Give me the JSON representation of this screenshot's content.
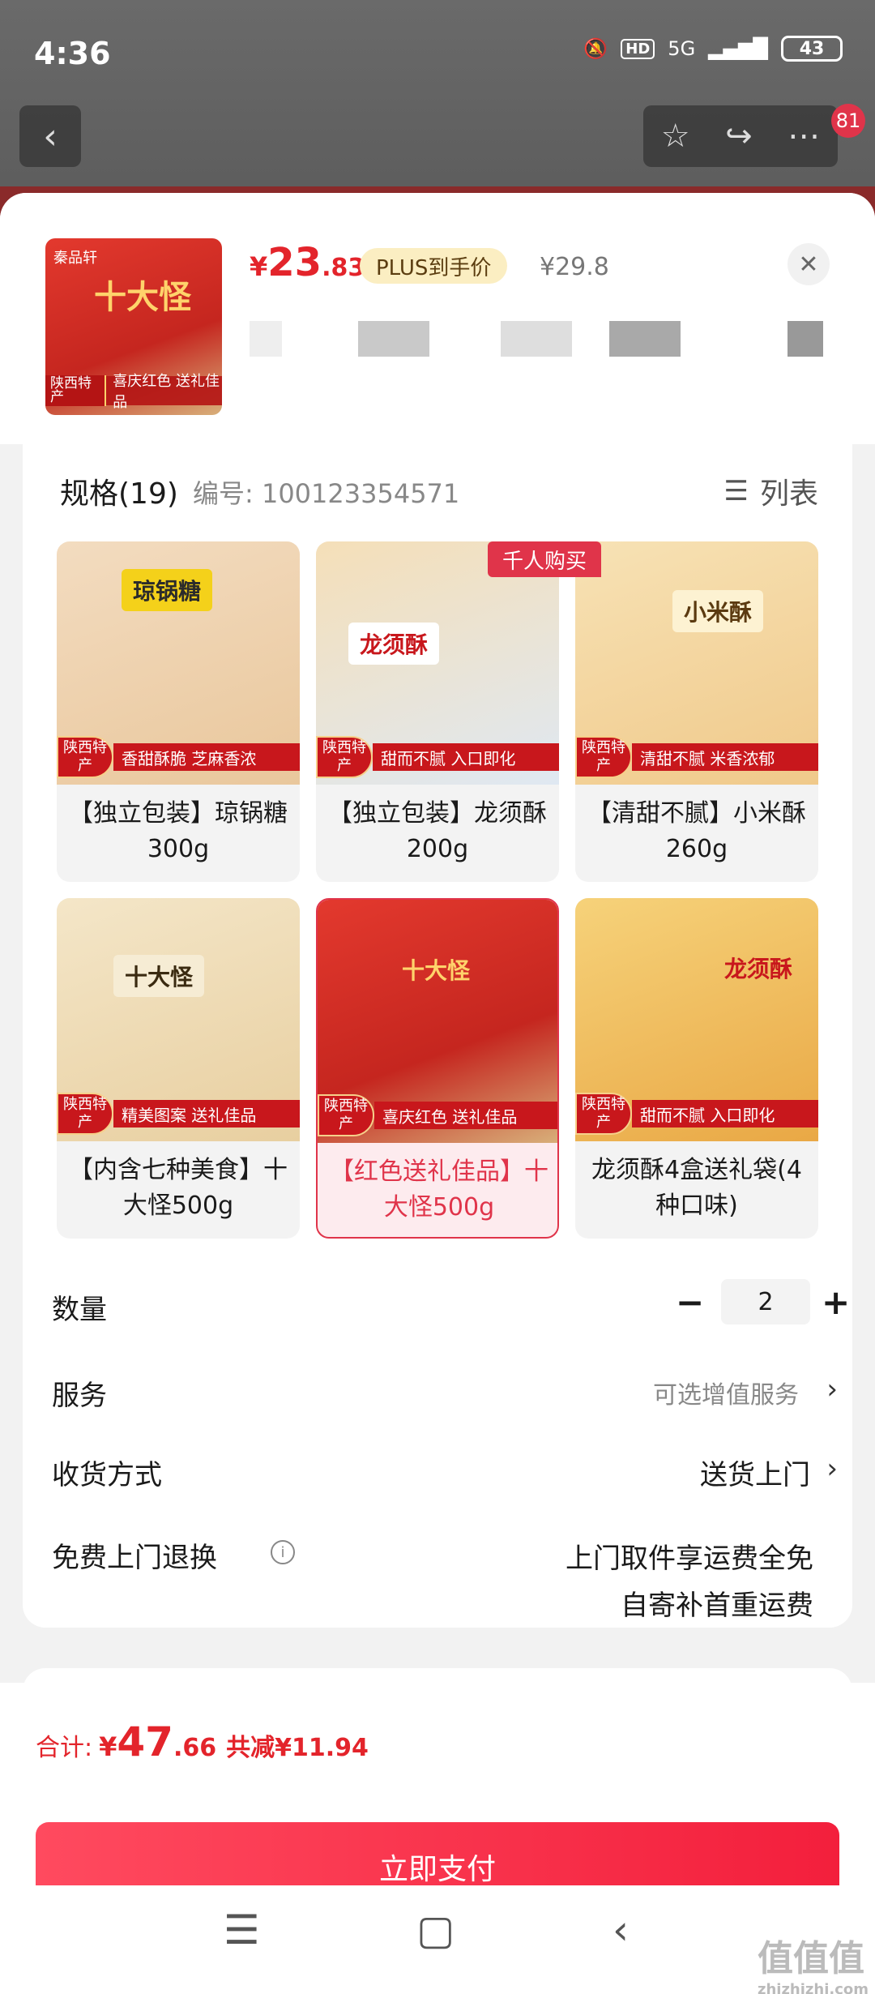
{
  "status": {
    "time": "4:36",
    "net": "5G",
    "hd": "HD",
    "battery": "43"
  },
  "nav": {
    "badge": "81"
  },
  "header": {
    "price_currency": "¥",
    "price_int": "23",
    "price_dec": ".83",
    "plus_label": "PLUS到手价",
    "orig_price": "¥29.8",
    "thumb_title": "十大怪",
    "thumb_origin": "陕西特产",
    "thumb_slogan": "喜庆红色 送礼佳品"
  },
  "spec": {
    "title": "规格(19)",
    "sku": "编号: 100123354571",
    "list_label": "列表",
    "hot_tag": "千人购买",
    "items": [
      {
        "label": "【独立包装】琼锅糖300g",
        "product_name": "琼锅糖",
        "slogan": "香甜酥脆 芝麻香浓",
        "origin": "陕西特产",
        "selected": false
      },
      {
        "label": "【独立包装】龙须酥200g",
        "product_name": "龙须酥",
        "slogan": "甜而不腻 入口即化",
        "origin": "陕西特产",
        "selected": false
      },
      {
        "label": "【清甜不腻】小米酥260g",
        "product_name": "小米酥",
        "slogan": "清甜不腻 米香浓郁",
        "origin": "陕西特产",
        "selected": false
      },
      {
        "label": "【内含七种美食】十大怪500g",
        "product_name": "十大怪",
        "slogan": "精美图案 送礼佳品",
        "origin": "陕西特产",
        "selected": false
      },
      {
        "label": "【红色送礼佳品】十大怪500g",
        "product_name": "十大怪",
        "slogan": "喜庆红色 送礼佳品",
        "origin": "陕西特产",
        "selected": true
      },
      {
        "label": "龙须酥4盒送礼袋(4种口味)",
        "product_name": "龙须酥",
        "slogan": "甜而不腻 入口即化",
        "origin": "陕西特产",
        "selected": false
      }
    ]
  },
  "quantity": {
    "label": "数量",
    "minus": "−",
    "value": "2",
    "plus": "+"
  },
  "service": {
    "label": "服务",
    "hint": "可选增值服务"
  },
  "delivery": {
    "label": "收货方式",
    "value": "送货上门"
  },
  "returns": {
    "label": "免费上门退换",
    "line1": "上门取件享运费全免",
    "line2": "自寄补首重运费"
  },
  "footer": {
    "total_label": "合计:",
    "total_currency": "¥",
    "total_int": "47",
    "total_dec": ".66",
    "saving": "共减¥11.94",
    "pay_label": "立即支付"
  },
  "watermark": {
    "mark": "值值值",
    "site": "zhizhizhi.com"
  },
  "colors": {
    "accent": "#e3242b",
    "pay_button": "#f31f3c",
    "plus_badge": "#fbeec2",
    "selected_bg": "#fdebee"
  },
  "icons": [
    "back-icon",
    "star-icon",
    "share-icon",
    "more-icon",
    "close-icon",
    "list-icon",
    "chevron-right-icon",
    "info-icon",
    "menu-icon",
    "home-icon",
    "back-nav-icon"
  ]
}
